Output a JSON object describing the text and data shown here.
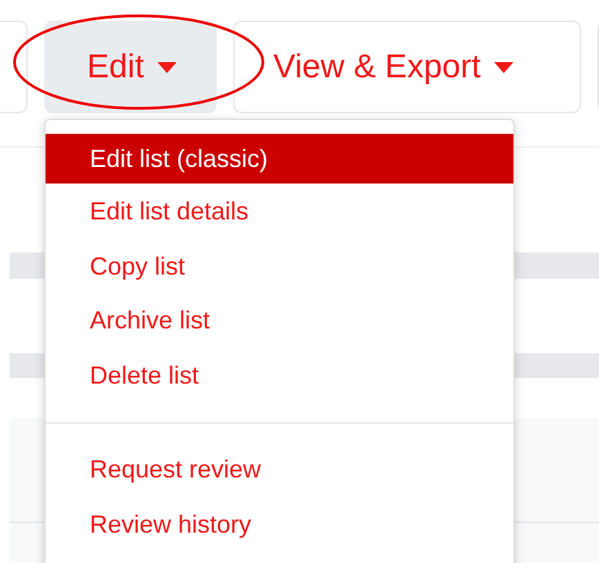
{
  "toolbar": {
    "buttons": [
      {
        "label": "Edit",
        "caret": true,
        "selected": true
      },
      {
        "label": "View & Export",
        "caret": true,
        "selected": false
      }
    ]
  },
  "menu": {
    "sections": [
      [
        {
          "label": "Edit list (classic)",
          "selected": true
        },
        {
          "label": "Edit list details",
          "selected": false
        },
        {
          "label": "Copy list",
          "selected": false
        },
        {
          "label": "Archive list",
          "selected": false
        },
        {
          "label": "Delete list",
          "selected": false
        }
      ],
      [
        {
          "label": "Request review",
          "selected": false
        },
        {
          "label": "Review history",
          "selected": false
        }
      ]
    ]
  }
}
